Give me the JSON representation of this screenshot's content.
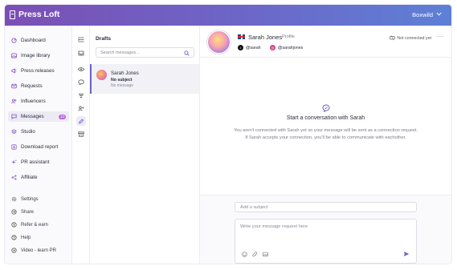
{
  "app": {
    "brand": "Press Loft",
    "account": "Boxwild"
  },
  "sidebar": {
    "items": [
      {
        "label": "Dashboard",
        "icon": "dashboard-icon"
      },
      {
        "label": "Image library",
        "icon": "image-icon"
      },
      {
        "label": "Press releases",
        "icon": "megaphone-icon"
      },
      {
        "label": "Requests",
        "icon": "inbox-icon"
      },
      {
        "label": "Influencers",
        "icon": "users-icon"
      },
      {
        "label": "Messages",
        "icon": "message-icon",
        "badge": "13",
        "active": true
      },
      {
        "label": "Studio",
        "icon": "studio-icon"
      },
      {
        "label": "Download report",
        "icon": "download-icon"
      },
      {
        "label": "PR assistant",
        "icon": "sparkle-icon"
      },
      {
        "label": "Affiliate",
        "icon": "affiliate-icon"
      }
    ],
    "utility": [
      {
        "label": "Settings",
        "icon": "gear-icon"
      },
      {
        "label": "Share",
        "icon": "share-icon"
      },
      {
        "label": "Refer & earn",
        "icon": "gift-icon"
      },
      {
        "label": "Help",
        "icon": "help-icon"
      },
      {
        "label": "Video - learn PR",
        "icon": "play-icon"
      }
    ]
  },
  "rail": {
    "icons": [
      "collapse-icon",
      "inbox-tray-icon",
      "eye-icon",
      "chat-icon",
      "filter-icon",
      "add-user-icon",
      "pencil-icon",
      "archive-icon"
    ],
    "active": "pencil-icon"
  },
  "drafts": {
    "title": "Drafts",
    "search_placeholder": "Search messages...",
    "threads": [
      {
        "name": "Sarah Jones",
        "subject": "No subject",
        "preview": "No message"
      }
    ]
  },
  "conversation": {
    "name": "Sarah Jones",
    "role": "Profile",
    "tiktok": "@sarah",
    "instagram": "@sarahjones",
    "status": "Not connected yet",
    "empty_title": "Start a conversation with Sarah",
    "empty_text": "You aren't connected with Sarah yet so your message will be sent as a connection request. If Sarah accepts your connection, you'll be able to communicate with eachother."
  },
  "composer": {
    "subject_placeholder": "Add a subject",
    "message_placeholder": "Write your message request here"
  },
  "colors": {
    "brand_gradient_start": "#7b4fb5",
    "brand_gradient_end": "#5d80d6",
    "accent": "#6d62c9",
    "badge": "#b86bd6"
  }
}
